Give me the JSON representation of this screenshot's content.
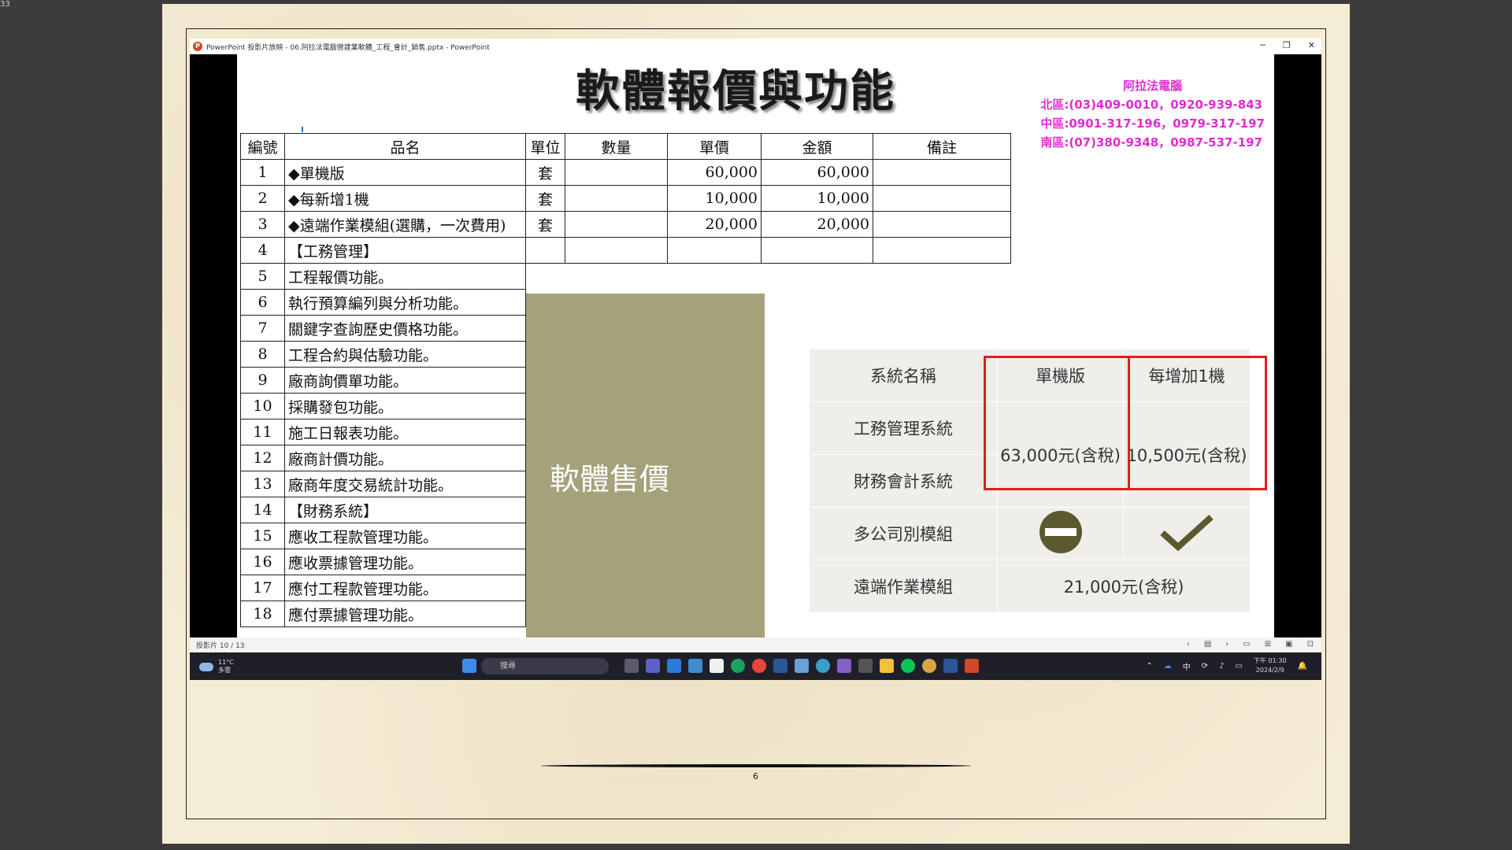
{
  "corner_text": "33",
  "window": {
    "title": "PowerPoint 投影片放映 - 06.阿拉法電腦營建業軟體_工程_會計_銷售.pptx - PowerPoint",
    "minimize": "─",
    "restore": "❐",
    "close": "✕"
  },
  "slide": {
    "title": "軟體報價與功能",
    "contact": {
      "company": "阿拉法電腦",
      "north": "北區:(03)409-0010，0920-939-843",
      "central": "中區:0901-317-196，0979-317-197",
      "south": "南區:(07)380-9348，0987-537-197"
    },
    "table": {
      "headers": [
        "編號",
        "品名",
        "單位",
        "數量",
        "單價",
        "金額",
        "備註"
      ],
      "priced_rows": [
        {
          "no": "1",
          "name": "◆單機版",
          "unit": "套",
          "qty": "",
          "price": "60,000",
          "amount": "60,000",
          "note": ""
        },
        {
          "no": "2",
          "name": "◆每新增1機",
          "unit": "套",
          "qty": "",
          "price": "10,000",
          "amount": "10,000",
          "note": ""
        },
        {
          "no": "3",
          "name": "◆遠端作業模組(選購，一次費用)",
          "unit": "套",
          "qty": "",
          "price": "20,000",
          "amount": "20,000",
          "note": ""
        },
        {
          "no": "4",
          "name": "【工務管理】",
          "unit": "",
          "qty": "",
          "price": "",
          "amount": "",
          "note": ""
        }
      ],
      "feature_rows": [
        {
          "no": "5",
          "name": "工程報價功能。"
        },
        {
          "no": "6",
          "name": "執行預算編列與分析功能。"
        },
        {
          "no": "7",
          "name": "關鍵字查詢歷史價格功能。"
        },
        {
          "no": "8",
          "name": "工程合約與估驗功能。"
        },
        {
          "no": "9",
          "name": "廠商詢價單功能。"
        },
        {
          "no": "10",
          "name": "採購發包功能。"
        },
        {
          "no": "11",
          "name": "施工日報表功能。"
        },
        {
          "no": "12",
          "name": "廠商計價功能。"
        },
        {
          "no": "13",
          "name": "廠商年度交易統計功能。"
        },
        {
          "no": "14",
          "name": "【財務系統】"
        },
        {
          "no": "15",
          "name": "應收工程款管理功能。"
        },
        {
          "no": "16",
          "name": "應收票據管理功能。"
        },
        {
          "no": "17",
          "name": "應付工程款管理功能。"
        },
        {
          "no": "18",
          "name": "應付票據管理功能。"
        }
      ]
    },
    "price_box_label": "軟體售價",
    "comparison": {
      "col_system": "系統名稱",
      "col_single": "單機版",
      "col_each": "每增加1機",
      "row_works": "工務管理系統",
      "row_finance": "財務會計系統",
      "price_single": "63,000元(含稅)",
      "price_each": "10,500元(含稅)",
      "row_multi": "多公司別模組",
      "multi_single_icon": "minus-circle-icon",
      "multi_each_icon": "checkmark-icon",
      "row_remote": "遠端作業模組",
      "price_remote": "21,000元(含稅)"
    }
  },
  "statusbar": {
    "slide_count": "投影片 10 / 13"
  },
  "taskbar": {
    "temperature": "11°C",
    "weather": "多雲",
    "search_placeholder": "搜尋",
    "ime": "中",
    "time": "下午 01:30",
    "date": "2024/2/9"
  },
  "document": {
    "page_number": "6"
  },
  "colors": {
    "contact": "#e02bd0",
    "price_box": "#a5a17a",
    "highlight_box": "#e01e1e",
    "checkmark": "#5b5a2e"
  }
}
